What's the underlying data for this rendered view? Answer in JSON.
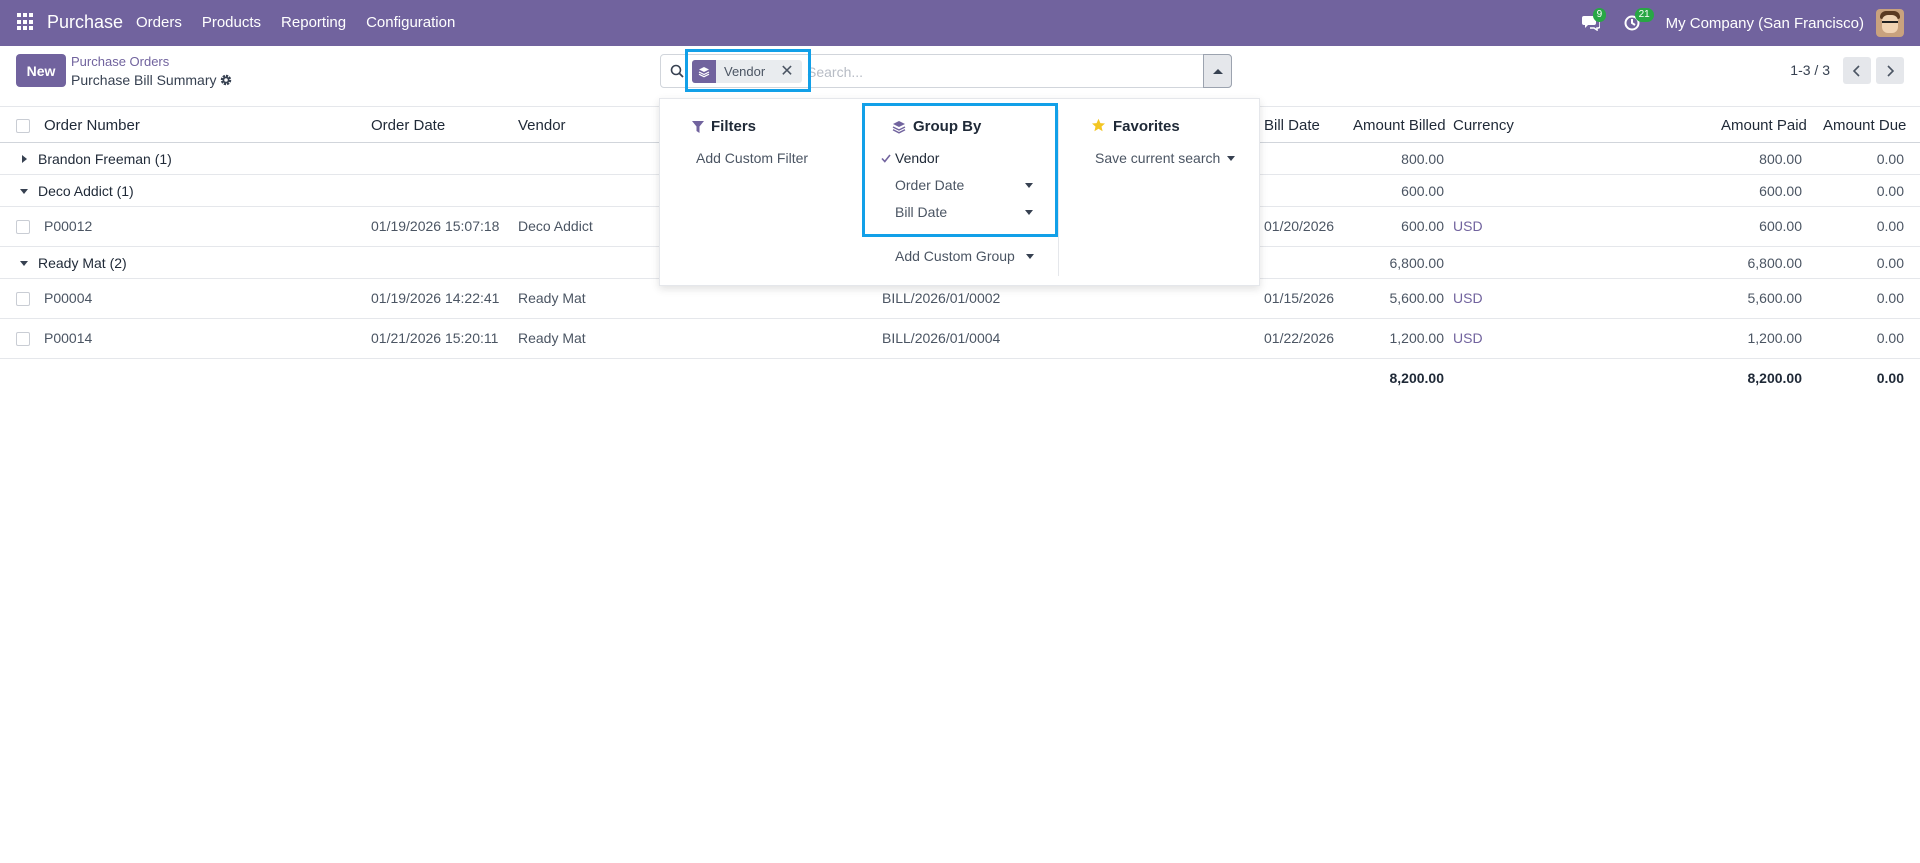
{
  "navbar": {
    "brand": "Purchase",
    "menu": [
      "Orders",
      "Products",
      "Reporting",
      "Configuration"
    ],
    "messages_count": "9",
    "activities_count": "21",
    "company": "My Company (San Francisco)"
  },
  "control": {
    "new_label": "New",
    "breadcrumb_parent": "Purchase Orders",
    "page_title": "Purchase Bill Summary",
    "search": {
      "facet_label": "Vendor",
      "placeholder": "Search..."
    },
    "pager": "1-3 / 3"
  },
  "dropdown": {
    "filters": {
      "title": "Filters",
      "items": [
        "Add Custom Filter"
      ]
    },
    "group_by": {
      "title": "Group By",
      "items": [
        "Vendor",
        "Order Date",
        "Bill Date"
      ],
      "add_custom": "Add Custom Group",
      "active": "Vendor"
    },
    "favorites": {
      "title": "Favorites",
      "items": [
        "Save current search"
      ]
    }
  },
  "table": {
    "columns": [
      "Order Number",
      "Order Date",
      "Vendor",
      "Bill Date",
      "Amount Billed",
      "Currency",
      "Amount Paid",
      "Amount Due"
    ],
    "groups": [
      {
        "name": "Brandon Freeman (1)",
        "expanded": false,
        "billed": "800.00",
        "paid": "800.00",
        "due": "0.00",
        "rows": []
      },
      {
        "name": "Deco Addict (1)",
        "expanded": true,
        "billed": "600.00",
        "paid": "600.00",
        "due": "0.00",
        "rows": [
          {
            "order": "P00012",
            "date": "01/19/2026 15:07:18",
            "vendor": "Deco Addict",
            "bill_ref": "",
            "bill_date": "01/20/2026",
            "billed": "600.00",
            "currency": "USD",
            "paid": "600.00",
            "due": "0.00"
          }
        ]
      },
      {
        "name": "Ready Mat (2)",
        "expanded": true,
        "billed": "6,800.00",
        "paid": "6,800.00",
        "due": "0.00",
        "rows": [
          {
            "order": "P00004",
            "date": "01/19/2026 14:22:41",
            "vendor": "Ready Mat",
            "bill_ref": "BILL/2026/01/0002",
            "bill_date": "01/15/2026",
            "billed": "5,600.00",
            "currency": "USD",
            "paid": "5,600.00",
            "due": "0.00"
          },
          {
            "order": "P00014",
            "date": "01/21/2026 15:20:11",
            "vendor": "Ready Mat",
            "bill_ref": "BILL/2026/01/0004",
            "bill_date": "01/22/2026",
            "billed": "1,200.00",
            "currency": "USD",
            "paid": "1,200.00",
            "due": "0.00"
          }
        ]
      }
    ],
    "totals": {
      "billed": "8,200.00",
      "paid": "8,200.00",
      "due": "0.00"
    }
  },
  "colors": {
    "brand": "#71639e",
    "highlight": "#12a0e8",
    "badge": "#28a745"
  },
  "icons": [
    "apps-icon",
    "chat-icon",
    "clock-icon",
    "gear-icon",
    "search-icon",
    "layers-icon",
    "close-icon",
    "filter-icon",
    "star-icon",
    "check-icon",
    "chevron-left-icon",
    "chevron-right-icon"
  ]
}
